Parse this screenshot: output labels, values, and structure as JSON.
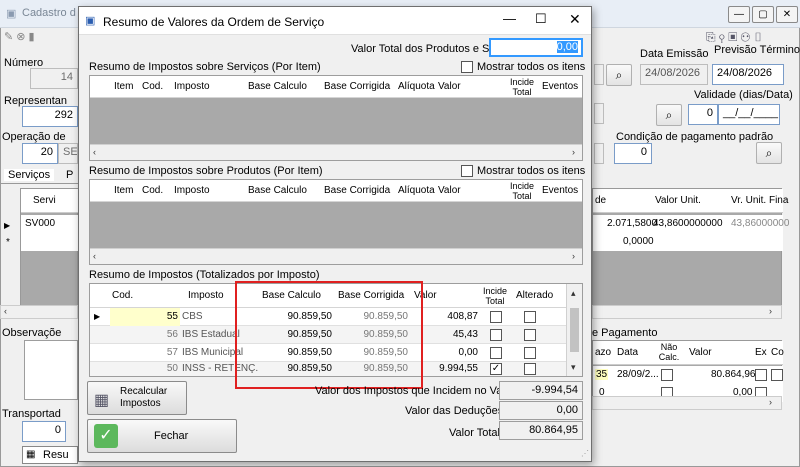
{
  "background": {
    "title": "Cadastro d",
    "field_labels": {
      "numero": "Número",
      "representante": "Representan",
      "operacao": "Operação de",
      "observacoes": "Observaçõe",
      "transportado": "Transportad",
      "data_emissao": "Data Emissão",
      "previsao_termino": "Previsão Término",
      "validade": "Validade (dias/Data)",
      "condicao_pagamento": "Condição de pagamento padrão",
      "pagamento_group": "e Pagamento"
    },
    "values": {
      "numero": "14",
      "representante": "292",
      "operacao_code": "20",
      "operacao_text": "SE",
      "transportado": "0",
      "data_emissao": "24/08/2026",
      "previsao_termino": "24/08/2026",
      "validade_dias": "0",
      "validade_data": "__/__/____",
      "condicao_pagamento": "0"
    },
    "tabs": [
      "Serviços",
      "P"
    ],
    "services_grid": {
      "headers": [
        "Servi",
        "de",
        "Valor Unit.",
        "Vr. Unit. Fina"
      ],
      "row1": {
        "code": "SV000",
        "qty": "2.071,5800",
        "unit": "43,8600000000",
        "final": "43,86000000"
      },
      "row2": {
        "unit": "0,0000"
      }
    },
    "payment_grid": {
      "headers": [
        "azo",
        "Data",
        "Não Calc.",
        "Valor",
        "Ex",
        "Co"
      ],
      "row1": {
        "prazo": "35",
        "data": "28/09/2...",
        "valor": "80.864,96"
      },
      "row2": {
        "prazo": "0",
        "valor": "0,00"
      }
    },
    "bottom_tab": "Resu"
  },
  "modal": {
    "title": "Resumo de Valores da Ordem de Serviço",
    "valor_total_label": "Valor Total dos Produtos e Serviços",
    "valor_total_value": "0,00",
    "services_section": {
      "title": "Resumo de Impostos sobre Serviços (Por Item)",
      "show_all_label": "Mostrar todos os itens",
      "headers": [
        "Item",
        "Cod.",
        "Imposto",
        "Base Calculo",
        "Base Corrigida",
        "Alíquota",
        "Valor",
        "Incide Total",
        "Eventos"
      ]
    },
    "products_section": {
      "title": "Resumo de Impostos sobre Produtos (Por Item)",
      "show_all_label": "Mostrar todos os itens",
      "headers": [
        "Item",
        "Cod.",
        "Imposto",
        "Base Calculo",
        "Base Corrigida",
        "Alíquota",
        "Valor",
        "Incide Total",
        "Eventos"
      ]
    },
    "totals_section": {
      "title": "Resumo de Impostos (Totalizados por Imposto)",
      "headers": [
        "Cod.",
        "Imposto",
        "Base Calculo",
        "Base Corrigida",
        "Valor",
        "Incide Total",
        "Alterado"
      ],
      "rows": [
        {
          "cod": "55",
          "imposto": "CBS",
          "base": "90.859,50",
          "corrigida": "90.859,50",
          "valor": "408,87",
          "incide": false,
          "alterado": false
        },
        {
          "cod": "56",
          "imposto": "IBS Estadual",
          "base": "90.859,50",
          "corrigida": "90.859,50",
          "valor": "45,43",
          "incide": false,
          "alterado": false
        },
        {
          "cod": "57",
          "imposto": "IBS Municipal",
          "base": "90.859,50",
          "corrigida": "90.859,50",
          "valor": "0,00",
          "incide": false,
          "alterado": false
        },
        {
          "cod": "50",
          "imposto": "INSS - RETENÇ...",
          "base": "90.859,50",
          "corrigida": "90.859,50",
          "valor": "9.994,55",
          "incide": true,
          "alterado": false
        }
      ]
    },
    "buttons": {
      "recalcular": "Recalcular Impostos",
      "fechar": "Fechar"
    },
    "summary": {
      "impostos_label": "Valor dos Impostos que Incidem no Valor Total",
      "impostos_value": "-9.994,54",
      "deducoes_label": "Valor das Deduções",
      "deducoes_value": "0,00",
      "total_label": "Valor Total",
      "total_value": "80.864,95"
    }
  },
  "colors": {
    "highlight_box": "#e02020",
    "selected_field": "#3399ff",
    "grid_empty": "#a9a9a9"
  }
}
